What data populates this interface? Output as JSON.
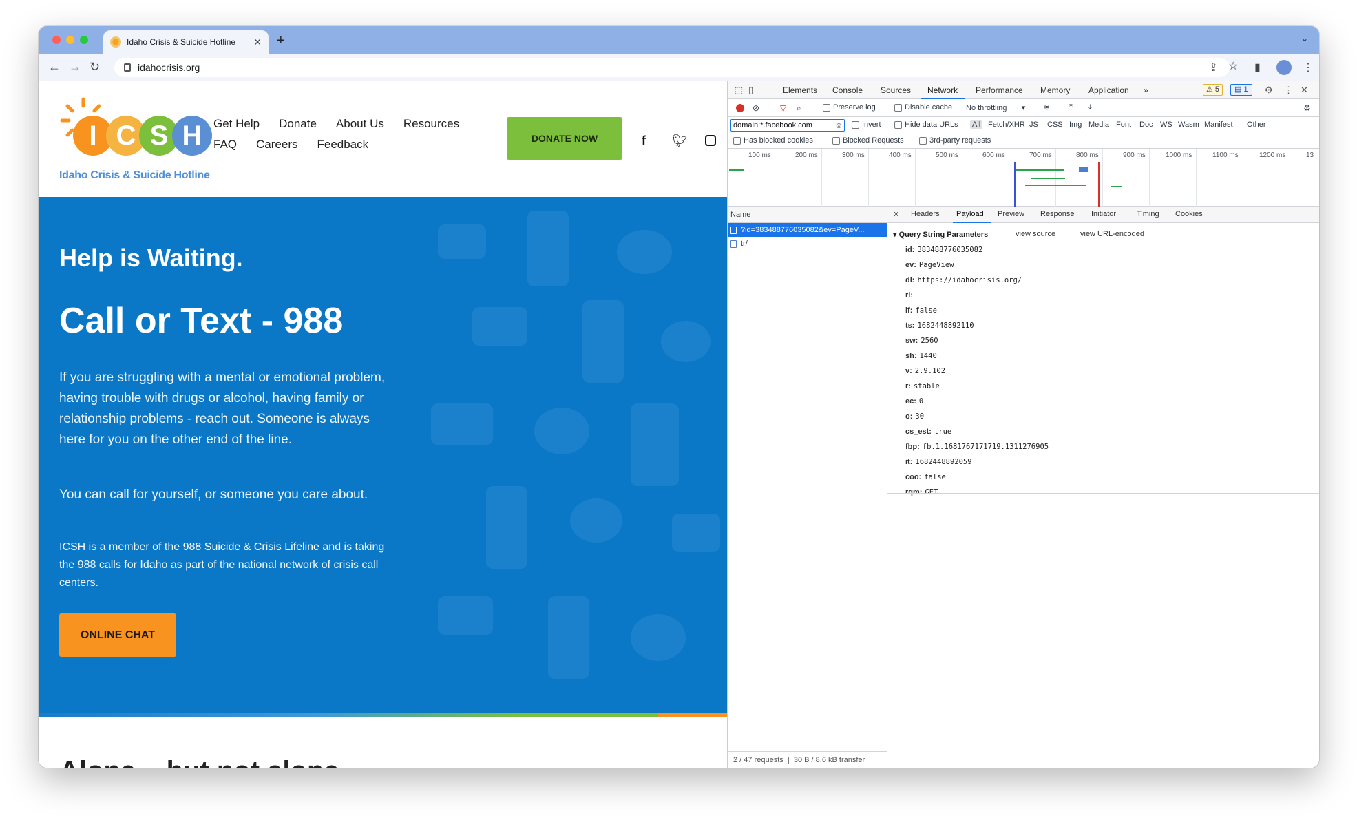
{
  "browser": {
    "tab_title": "Idaho Crisis & Suicide Hotline",
    "url": "idahocrisis.org"
  },
  "site": {
    "logo_letters": [
      "I",
      "C",
      "S",
      "H"
    ],
    "logo_colors": [
      "#f7931e",
      "#f7a21b",
      "#7cbf3c",
      "#5a8fd3"
    ],
    "logo_tagline": "Idaho Crisis & Suicide Hotline",
    "nav_row1": [
      "Get Help",
      "Donate",
      "About Us",
      "Resources"
    ],
    "nav_row2": [
      "FAQ",
      "Careers",
      "Feedback"
    ],
    "donate_label": "DONATE NOW",
    "social": [
      "facebook-icon",
      "twitter-icon",
      "instagram-icon"
    ]
  },
  "hero": {
    "subtitle": "Help is Waiting.",
    "title": "Call or Text - 988",
    "para1": "If you are struggling with a mental or emotional problem, having trouble with drugs or alcohol, having family or relationship problems - reach out. Someone is always here for you on the other end of the line.",
    "para2": " You can call for yourself, or someone you care about.",
    "para3_pre": "ICSH is a member of the ",
    "para3_link": "988 Suicide & Crisis Lifeline",
    "para3_post": " and is taking the 988 calls for Idaho as part of the national network of crisis call centers.",
    "chat_label": "ONLINE CHAT",
    "bg_color": "#0a77c7"
  },
  "next_section_title": "Alone... but not alone.",
  "devtools": {
    "tabs": [
      "Elements",
      "Console",
      "Sources",
      "Network",
      "Performance",
      "Memory",
      "Application"
    ],
    "active_tab": "Network",
    "warnings": "5",
    "messages": "1",
    "toolbar": {
      "preserve_log": "Preserve log",
      "disable_cache": "Disable cache",
      "throttling": "No throttling"
    },
    "filter": {
      "value": "domain:*.facebook.com",
      "invert": "Invert",
      "hide_data_urls": "Hide data URLs",
      "types": [
        "All",
        "Fetch/XHR",
        "JS",
        "CSS",
        "Img",
        "Media",
        "Font",
        "Doc",
        "WS",
        "Wasm",
        "Manifest",
        "Other"
      ],
      "has_blocked_cookies": "Has blocked cookies",
      "blocked_requests": "Blocked Requests",
      "third_party": "3rd-party requests"
    },
    "timeline_ticks": [
      "100 ms",
      "200 ms",
      "300 ms",
      "400 ms",
      "500 ms",
      "600 ms",
      "700 ms",
      "800 ms",
      "900 ms",
      "1000 ms",
      "1100 ms",
      "1200 ms",
      "13"
    ],
    "requests_header": "Name",
    "requests": [
      {
        "name": "?id=383488776035082&ev=PageV..."
      },
      {
        "name": "tr/"
      }
    ],
    "status": {
      "requests": "2 / 47 requests",
      "transfer": "30 B / 8.6 kB transfer"
    },
    "detail_tabs": [
      "Headers",
      "Payload",
      "Preview",
      "Response",
      "Initiator",
      "Timing",
      "Cookies"
    ],
    "active_detail_tab": "Payload",
    "qsp_title": "Query String Parameters",
    "view_source": "view source",
    "view_url_encoded": "view URL-encoded",
    "params": [
      {
        "key": "id:",
        "value": "383488776035082"
      },
      {
        "key": "ev:",
        "value": "PageView"
      },
      {
        "key": "dl:",
        "value": "https://idahocrisis.org/"
      },
      {
        "key": "rl:",
        "value": ""
      },
      {
        "key": "if:",
        "value": "false"
      },
      {
        "key": "ts:",
        "value": "1682448892110"
      },
      {
        "key": "sw:",
        "value": "2560"
      },
      {
        "key": "sh:",
        "value": "1440"
      },
      {
        "key": "v:",
        "value": "2.9.102"
      },
      {
        "key": "r:",
        "value": "stable"
      },
      {
        "key": "ec:",
        "value": "0"
      },
      {
        "key": "o:",
        "value": "30"
      },
      {
        "key": "cs_est:",
        "value": "true"
      },
      {
        "key": "fbp:",
        "value": "fb.1.1681767171719.1311276905"
      },
      {
        "key": "it:",
        "value": "1682448892059"
      },
      {
        "key": "coo:",
        "value": "false"
      },
      {
        "key": "rqm:",
        "value": "GET"
      }
    ]
  }
}
